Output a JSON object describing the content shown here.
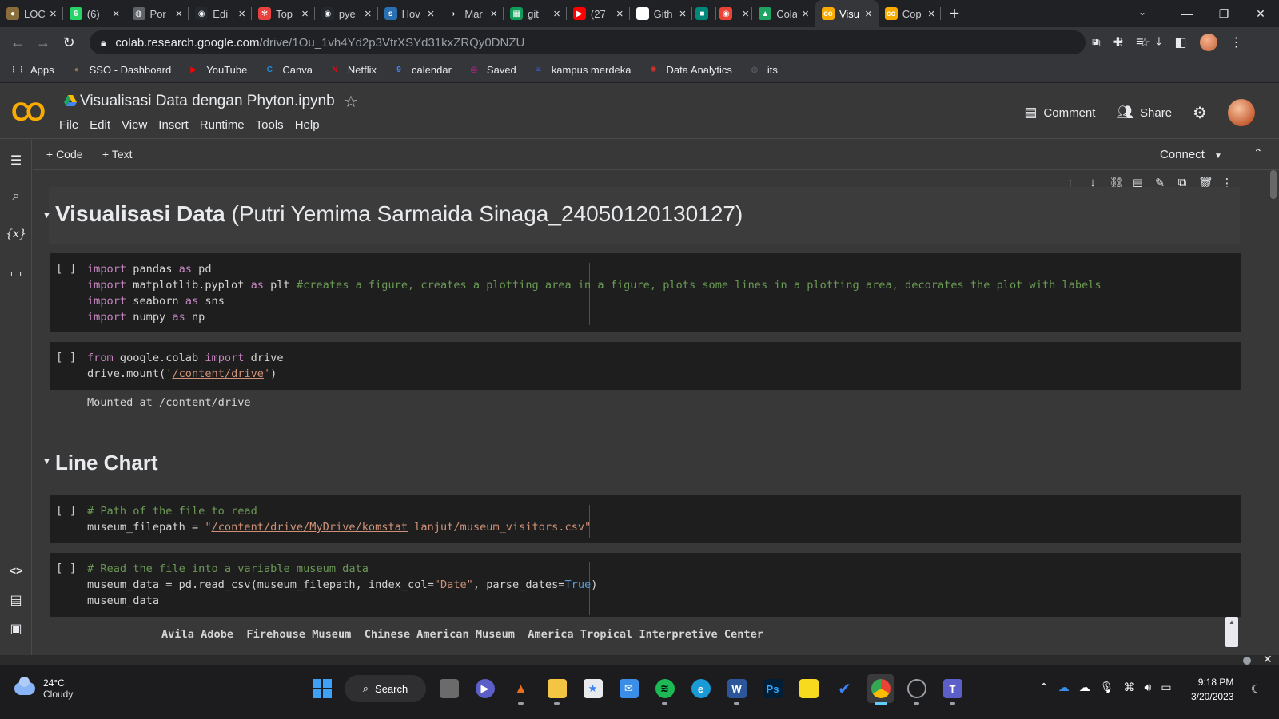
{
  "browser": {
    "tabs": [
      {
        "title": "LOC",
        "icon": "generic-tab-icon",
        "color": "#8a6d3b",
        "glyph": "●"
      },
      {
        "title": "(6)",
        "icon": "whatsapp-icon",
        "color": "#25d366",
        "glyph": "6"
      },
      {
        "title": "Por",
        "icon": "globe-icon",
        "color": "#5f6368",
        "glyph": "◍"
      },
      {
        "title": "Edi",
        "icon": "github-icon",
        "color": "#24292e",
        "glyph": "◉"
      },
      {
        "title": "Top",
        "icon": "tableau-icon",
        "color": "#e8423f",
        "glyph": "✻"
      },
      {
        "title": "pye",
        "icon": "github-icon",
        "color": "#24292e",
        "glyph": "◉"
      },
      {
        "title": "Hov",
        "icon": "site-icon",
        "color": "#2a6fb0",
        "glyph": "s"
      },
      {
        "title": "Mar",
        "icon": "arrow-icon",
        "color": "#202124",
        "glyph": "›"
      },
      {
        "title": "git",
        "icon": "sheets-icon",
        "color": "#0f9d58",
        "glyph": "▦"
      },
      {
        "title": "(27",
        "icon": "youtube-icon",
        "color": "#ff0000",
        "glyph": "▶"
      },
      {
        "title": "Gith",
        "icon": "site-icon",
        "color": "#ffffff",
        "glyph": "m"
      },
      {
        "title": "",
        "icon": "meet-icon",
        "color": "#00897b",
        "glyph": "■"
      },
      {
        "title": "",
        "icon": "record-icon",
        "color": "#ea4335",
        "glyph": "◉"
      },
      {
        "title": "Cola",
        "icon": "google-drive-icon",
        "color": "#1fa463",
        "glyph": "▲"
      },
      {
        "title": "Visu",
        "icon": "colab-icon",
        "color": "#f9ab00",
        "glyph": "co",
        "active": true
      },
      {
        "title": "Cop",
        "icon": "colab-icon",
        "color": "#f9ab00",
        "glyph": "co"
      }
    ],
    "url_host": "colab.research.google.com",
    "url_path": "/drive/1Ou_1vh4Yd2p3VtrXSYd31kxZRQy0DNZU",
    "bookmarks": [
      {
        "label": "Apps",
        "icon": "apps-grid-icon",
        "color": "#e8eaed",
        "glyph": "⋮⋮"
      },
      {
        "label": "SSO - Dashboard",
        "icon": "sso-icon",
        "color": "#8a7350",
        "glyph": "●"
      },
      {
        "label": "YouTube",
        "icon": "youtube-icon",
        "color": "#ff0000",
        "glyph": "▶"
      },
      {
        "label": "Canva",
        "icon": "canva-icon",
        "color": "#1f8fe0",
        "glyph": "C"
      },
      {
        "label": "Netflix",
        "icon": "netflix-icon",
        "color": "#e50914",
        "glyph": "N"
      },
      {
        "label": "calendar",
        "icon": "calendar-icon",
        "color": "#4285f4",
        "glyph": "9"
      },
      {
        "label": "Saved",
        "icon": "instagram-icon",
        "color": "#d6249f",
        "glyph": "◎"
      },
      {
        "label": "kampus merdeka",
        "icon": "kampus-merdeka-icon",
        "color": "#3b5bdb",
        "glyph": "≡"
      },
      {
        "label": "Data Analytics",
        "icon": "data-analytics-icon",
        "color": "#d93025",
        "glyph": "✺"
      },
      {
        "label": "its",
        "icon": "globe-icon",
        "color": "#5f6368",
        "glyph": "◍"
      }
    ]
  },
  "colab": {
    "notebook_title": "Visualisasi Data dengan Phyton.ipynb",
    "menu": [
      "File",
      "Edit",
      "View",
      "Insert",
      "Runtime",
      "Tools",
      "Help"
    ],
    "comment_label": "Comment",
    "share_label": "Share",
    "add_code_label": "+ Code",
    "add_text_label": "+ Text",
    "connect_label": "Connect"
  },
  "cells": {
    "h1_bold": "Visualisasi Data",
    "h1_rest": " (Putri Yemima Sarmaida Sinaga_24050120130127)",
    "cell1_run": "[ ]",
    "cell2_run": "[ ]",
    "cell2_output": "Mounted at /content/drive",
    "h2": "Line Chart",
    "cell3_run": "[ ]",
    "cell4_run": "[ ]",
    "df_header": "Avila Adobe  Firehouse Museum  Chinese American Museum  America Tropical Interpretive Center"
  },
  "taskbar": {
    "temperature": "24°C",
    "condition": "Cloudy",
    "search_label": "Search",
    "time": "9:18 PM",
    "date": "3/20/2023"
  }
}
